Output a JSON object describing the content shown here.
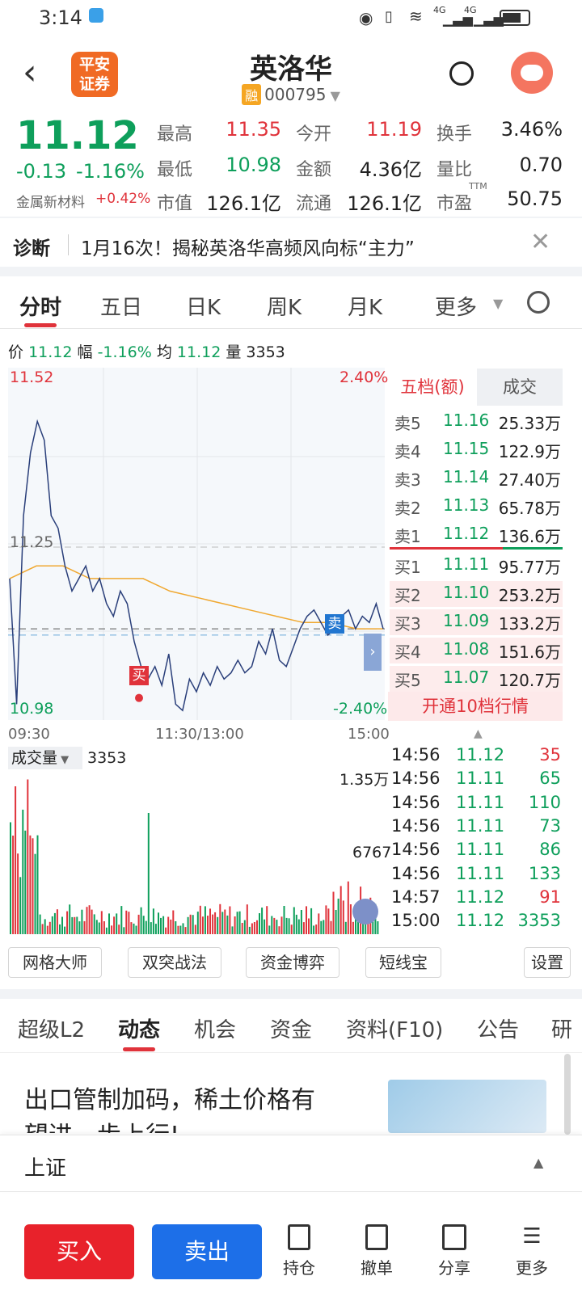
{
  "status_bar": {
    "time": "3:14",
    "net1": "4G",
    "net2": "4G"
  },
  "header": {
    "title": "英洛华",
    "margin_badge": "融",
    "code": "000795",
    "logo_line1": "平安",
    "logo_line2": "证券"
  },
  "quote": {
    "price": "11.12",
    "change": "-0.13",
    "change_pct": "-1.16%",
    "sector": "金属新材料",
    "sector_pct": "+0.42%",
    "stats": [
      {
        "label": "最高",
        "value": "11.35"
      },
      {
        "label": "今开",
        "value": "11.19"
      },
      {
        "label": "换手",
        "value": "3.46%"
      },
      {
        "label": "最低",
        "value": "10.98"
      },
      {
        "label": "金额",
        "value": "4.36亿"
      },
      {
        "label": "量比",
        "value": "0.70"
      },
      {
        "label": "市值",
        "value": "126.1亿"
      },
      {
        "label": "流通",
        "value": "126.1亿"
      },
      {
        "label": "市盈",
        "value": "50.75"
      }
    ],
    "ttm": "TTM"
  },
  "diagnosis": {
    "label": "诊断",
    "text": "1月16次！揭秘英洛华高频风向标“主力”"
  },
  "tabs": [
    "分时",
    "五日",
    "日K",
    "周K",
    "月K",
    "更多"
  ],
  "chart_info": {
    "price_label": "价",
    "price": "11.12",
    "range_label": "幅",
    "range": "-1.16%",
    "avg_label": "均",
    "avg": "11.12",
    "vol_label": "量",
    "vol": "3353"
  },
  "chart_data": {
    "type": "line",
    "y_top": "11.52",
    "y_bottom": "10.98",
    "y_mid": "11.25",
    "pct_top": "2.40%",
    "pct_bottom": "-2.40%",
    "x_labels": [
      "09:30",
      "11:30/13:00",
      "15:00"
    ],
    "buy_marker": "买",
    "sell_marker": "卖",
    "prices": [
      11.2,
      11.0,
      11.3,
      11.4,
      11.45,
      11.42,
      11.3,
      11.28,
      11.22,
      11.18,
      11.2,
      11.22,
      11.18,
      11.2,
      11.16,
      11.14,
      11.18,
      11.16,
      11.1,
      11.06,
      11.04,
      11.06,
      11.03,
      11.08,
      11.0,
      10.99,
      11.04,
      11.02,
      11.05,
      11.03,
      11.06,
      11.04,
      11.05,
      11.07,
      11.05,
      11.06,
      11.1,
      11.08,
      11.12,
      11.07,
      11.06,
      11.09,
      11.12,
      11.14,
      11.15,
      11.13,
      11.11,
      11.12,
      11.14,
      11.15,
      11.12,
      11.14,
      11.13,
      11.16,
      11.12
    ],
    "avg": [
      11.2,
      11.22,
      11.22,
      11.2,
      11.2,
      11.2,
      11.18,
      11.17,
      11.16,
      11.15,
      11.14,
      11.13,
      11.13,
      11.12,
      11.12
    ]
  },
  "volume": {
    "label": "成交量",
    "value": "3353",
    "max_label": "1.35万",
    "mid_label": "6767"
  },
  "order_book": {
    "tab1": "五档(额)",
    "tab2": "成交",
    "asks": [
      {
        "label": "卖5",
        "price": "11.16",
        "amount": "25.33万"
      },
      {
        "label": "卖4",
        "price": "11.15",
        "amount": "122.9万"
      },
      {
        "label": "卖3",
        "price": "11.14",
        "amount": "27.40万"
      },
      {
        "label": "卖2",
        "price": "11.13",
        "amount": "65.78万"
      },
      {
        "label": "卖1",
        "price": "11.12",
        "amount": "136.6万"
      }
    ],
    "bids": [
      {
        "label": "买1",
        "price": "11.11",
        "amount": "95.77万"
      },
      {
        "label": "买2",
        "price": "11.10",
        "amount": "253.2万"
      },
      {
        "label": "买3",
        "price": "11.09",
        "amount": "133.2万"
      },
      {
        "label": "买4",
        "price": "11.08",
        "amount": "151.6万"
      },
      {
        "label": "买5",
        "price": "11.07",
        "amount": "120.7万"
      }
    ],
    "upgrade": "开通10档行情"
  },
  "trades": [
    {
      "time": "14:56",
      "price": "11.12",
      "vol": "35",
      "dir": "up"
    },
    {
      "time": "14:56",
      "price": "11.11",
      "vol": "65",
      "dir": "down"
    },
    {
      "time": "14:56",
      "price": "11.11",
      "vol": "110",
      "dir": "down"
    },
    {
      "time": "14:56",
      "price": "11.11",
      "vol": "73",
      "dir": "down"
    },
    {
      "time": "14:56",
      "price": "11.11",
      "vol": "86",
      "dir": "down"
    },
    {
      "time": "14:56",
      "price": "11.11",
      "vol": "133",
      "dir": "down"
    },
    {
      "time": "14:57",
      "price": "11.12",
      "vol": "91",
      "dir": "up"
    },
    {
      "time": "15:00",
      "price": "11.12",
      "vol": "3353",
      "dir": "down"
    }
  ],
  "tools": [
    "网格大师",
    "双突战法",
    "资金博弈",
    "短线宝",
    "设置"
  ],
  "sub_tabs": [
    "超级L2",
    "动态",
    "机会",
    "资金",
    "资料(F10)",
    "公告",
    "研"
  ],
  "news": {
    "headline_line1": "出口管制加码，稀土价格有",
    "headline_line2": "望进一步上行!"
  },
  "index_bar": {
    "label": "上证"
  },
  "bottom": {
    "buy": "买入",
    "sell": "卖出",
    "hold": "持仓",
    "cancel": "撤单",
    "share": "分享",
    "more": "更多"
  },
  "colors": {
    "up": "#e0333b",
    "down": "#0e9f5b",
    "buy_btn": "#e8222b",
    "sell_btn": "#1d6fe8",
    "avg_line": "#f0a830",
    "price_line": "#2a3f7a"
  }
}
